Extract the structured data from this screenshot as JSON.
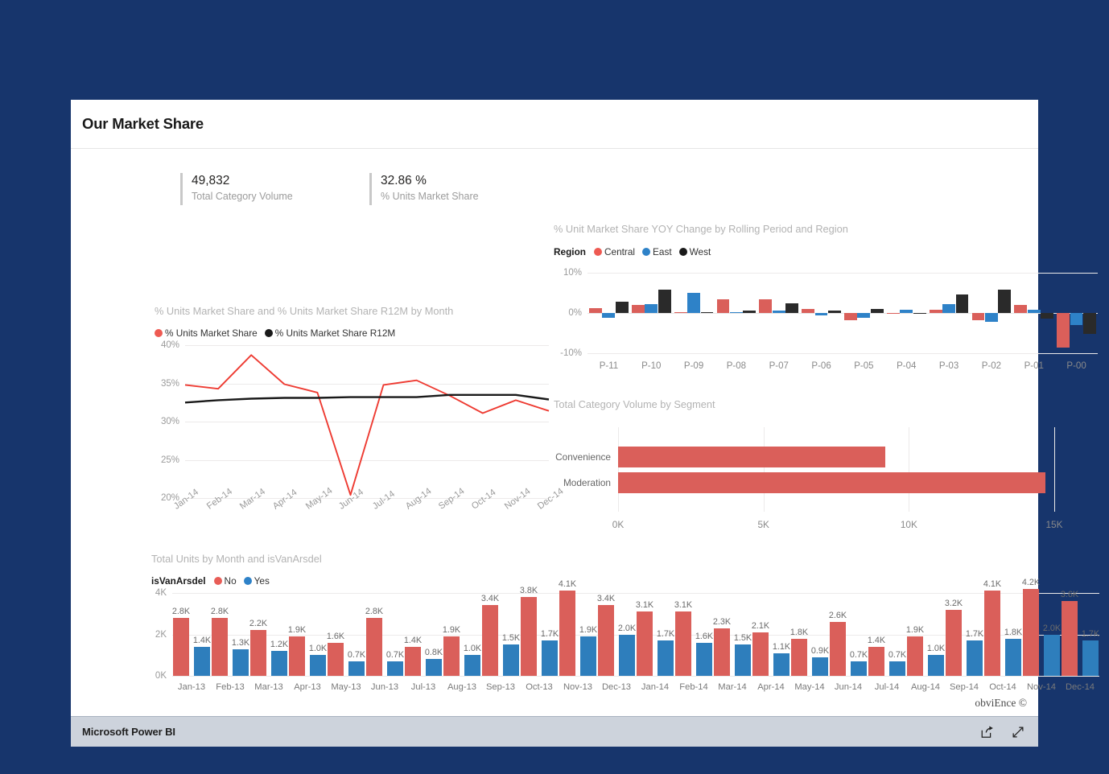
{
  "report": {
    "title": "Our Market Share",
    "watermark": "obviEnce ©",
    "footer": {
      "brand": "Microsoft Power BI",
      "share_icon": "share-icon",
      "fullscreen_icon": "fullscreen-icon"
    }
  },
  "kpis": [
    {
      "value": "49,832",
      "label": "Total Category Volume"
    },
    {
      "value": "32.86 %",
      "label": "% Units Market Share"
    }
  ],
  "colors": {
    "red": "#DA5F5A",
    "blue": "#2E7EBC",
    "black": "#2A2A2A",
    "background_navy": "#17356C",
    "line_red": "#EE3B32"
  },
  "chart_data": [
    {
      "id": "units_market_share_line",
      "type": "line",
      "title": "% Units Market Share and % Units Market Share R12M by Month",
      "xlabel": "",
      "ylabel": "",
      "ylim": [
        20,
        40
      ],
      "yticks": [
        "40%",
        "35%",
        "30%",
        "25%",
        "20%"
      ],
      "ytick_values": [
        40,
        35,
        30,
        25,
        20
      ],
      "grid": true,
      "legend_position": "top-left",
      "categories": [
        "Jan-14",
        "Feb-14",
        "Mar-14",
        "Apr-14",
        "May-14",
        "Jun-14",
        "Jul-14",
        "Aug-14",
        "Sep-14",
        "Oct-14",
        "Nov-14",
        "Dec-14"
      ],
      "series": [
        {
          "name": "% Units Market Share",
          "color": "#EE3B32",
          "values": [
            34.8,
            34.3,
            38.7,
            34.9,
            33.8,
            20.4,
            34.8,
            35.4,
            33.4,
            31.1,
            32.8,
            31.4
          ]
        },
        {
          "name": "% Units Market Share R12M",
          "color": "#1A1A1A",
          "values": [
            32.5,
            32.8,
            33.0,
            33.1,
            33.1,
            33.2,
            33.2,
            33.2,
            33.5,
            33.5,
            33.5,
            32.9
          ]
        }
      ]
    },
    {
      "id": "yoy_change_bars",
      "type": "bar",
      "title": "% Unit Market Share YOY Change by Rolling Period and Region",
      "legend_title": "Region",
      "legend_position": "top-left",
      "xlabel": "",
      "ylabel": "",
      "ylim": [
        -10,
        10
      ],
      "yticks": [
        "10%",
        "0%",
        "-10%"
      ],
      "ytick_values": [
        10,
        0,
        -10
      ],
      "grid": true,
      "categories": [
        "P-11",
        "P-10",
        "P-09",
        "P-08",
        "P-07",
        "P-06",
        "P-05",
        "P-04",
        "P-03",
        "P-02",
        "P-01",
        "P-00"
      ],
      "series": [
        {
          "name": "Central",
          "color": "#DA5F5A",
          "values": [
            1.2,
            2.0,
            0.3,
            3.4,
            3.4,
            1.1,
            -1.8,
            -0.2,
            0.8,
            -1.7,
            2.0,
            -8.5
          ]
        },
        {
          "name": "East",
          "color": "#2E82C8",
          "values": [
            -1.2,
            2.3,
            5.0,
            0.2,
            0.7,
            -0.5,
            -1.2,
            0.8,
            2.3,
            -2.2,
            0.8,
            -3.0
          ]
        },
        {
          "name": "West",
          "color": "#2A2A2A",
          "values": [
            2.8,
            5.8,
            0.3,
            0.7,
            2.5,
            0.7,
            1.0,
            -0.1,
            4.6,
            5.9,
            -1.4,
            -5.2
          ]
        }
      ]
    },
    {
      "id": "category_volume_by_segment",
      "type": "bar",
      "orientation": "horizontal",
      "title": "Total Category Volume by Segment",
      "xlabel": "",
      "ylabel": "",
      "xlim": [
        0,
        15000
      ],
      "xticks": [
        "0K",
        "5K",
        "10K",
        "15K"
      ],
      "xtick_values": [
        0,
        5000,
        10000,
        15000
      ],
      "grid": true,
      "categories": [
        "Convenience",
        "Moderation"
      ],
      "values": [
        9200,
        14700
      ],
      "color": "#DA5F5A"
    },
    {
      "id": "total_units_by_month",
      "type": "bar",
      "title": "Total Units by Month and isVanArsdel",
      "legend_title": "isVanArsdel",
      "legend_position": "top-left",
      "xlabel": "",
      "ylabel": "",
      "ylim": [
        0,
        4000
      ],
      "yticks": [
        "4K",
        "2K",
        "0K"
      ],
      "ytick_values": [
        4000,
        2000,
        0
      ],
      "grid": true,
      "categories": [
        "Jan-13",
        "Feb-13",
        "Mar-13",
        "Apr-13",
        "May-13",
        "Jun-13",
        "Jul-13",
        "Aug-13",
        "Sep-13",
        "Oct-13",
        "Nov-13",
        "Dec-13",
        "Jan-14",
        "Feb-14",
        "Mar-14",
        "Apr-14",
        "May-14",
        "Jun-14",
        "Jul-14",
        "Aug-14",
        "Sep-14",
        "Oct-14",
        "Nov-14",
        "Dec-14"
      ],
      "series": [
        {
          "name": "No",
          "color": "#DA5F5A",
          "values": [
            2800,
            2800,
            2200,
            1900,
            1600,
            2800,
            1400,
            1900,
            3400,
            3800,
            4100,
            3400,
            3100,
            3100,
            2300,
            2100,
            1800,
            2600,
            1400,
            1900,
            3200,
            4100,
            4200,
            3600
          ],
          "labels": [
            "2.8K",
            "2.8K",
            "2.2K",
            "1.9K",
            "1.6K",
            "2.8K",
            "1.4K",
            "1.9K",
            "3.4K",
            "3.8K",
            "4.1K",
            "3.4K",
            "3.1K",
            "3.1K",
            "2.3K",
            "2.1K",
            "1.8K",
            "2.6K",
            "1.4K",
            "1.9K",
            "3.2K",
            "4.1K",
            "4.2K",
            "3.6K"
          ]
        },
        {
          "name": "Yes",
          "color": "#2E7EBC",
          "values": [
            1400,
            1300,
            1200,
            1000,
            700,
            700,
            800,
            1000,
            1500,
            1700,
            1900,
            2000,
            1700,
            1600,
            1500,
            1100,
            900,
            700,
            700,
            1000,
            1700,
            1800,
            2000,
            1700
          ],
          "labels": [
            "1.4K",
            "1.3K",
            "1.2K",
            "1.0K",
            "0.7K",
            "0.7K",
            "0.8K",
            "1.0K",
            "1.5K",
            "1.7K",
            "1.9K",
            "2.0K",
            "1.7K",
            "1.6K",
            "1.5K",
            "1.1K",
            "0.9K",
            "0.7K",
            "0.7K",
            "1.0K",
            "1.7K",
            "1.8K",
            "2.0K",
            "1.7K"
          ]
        }
      ]
    }
  ]
}
